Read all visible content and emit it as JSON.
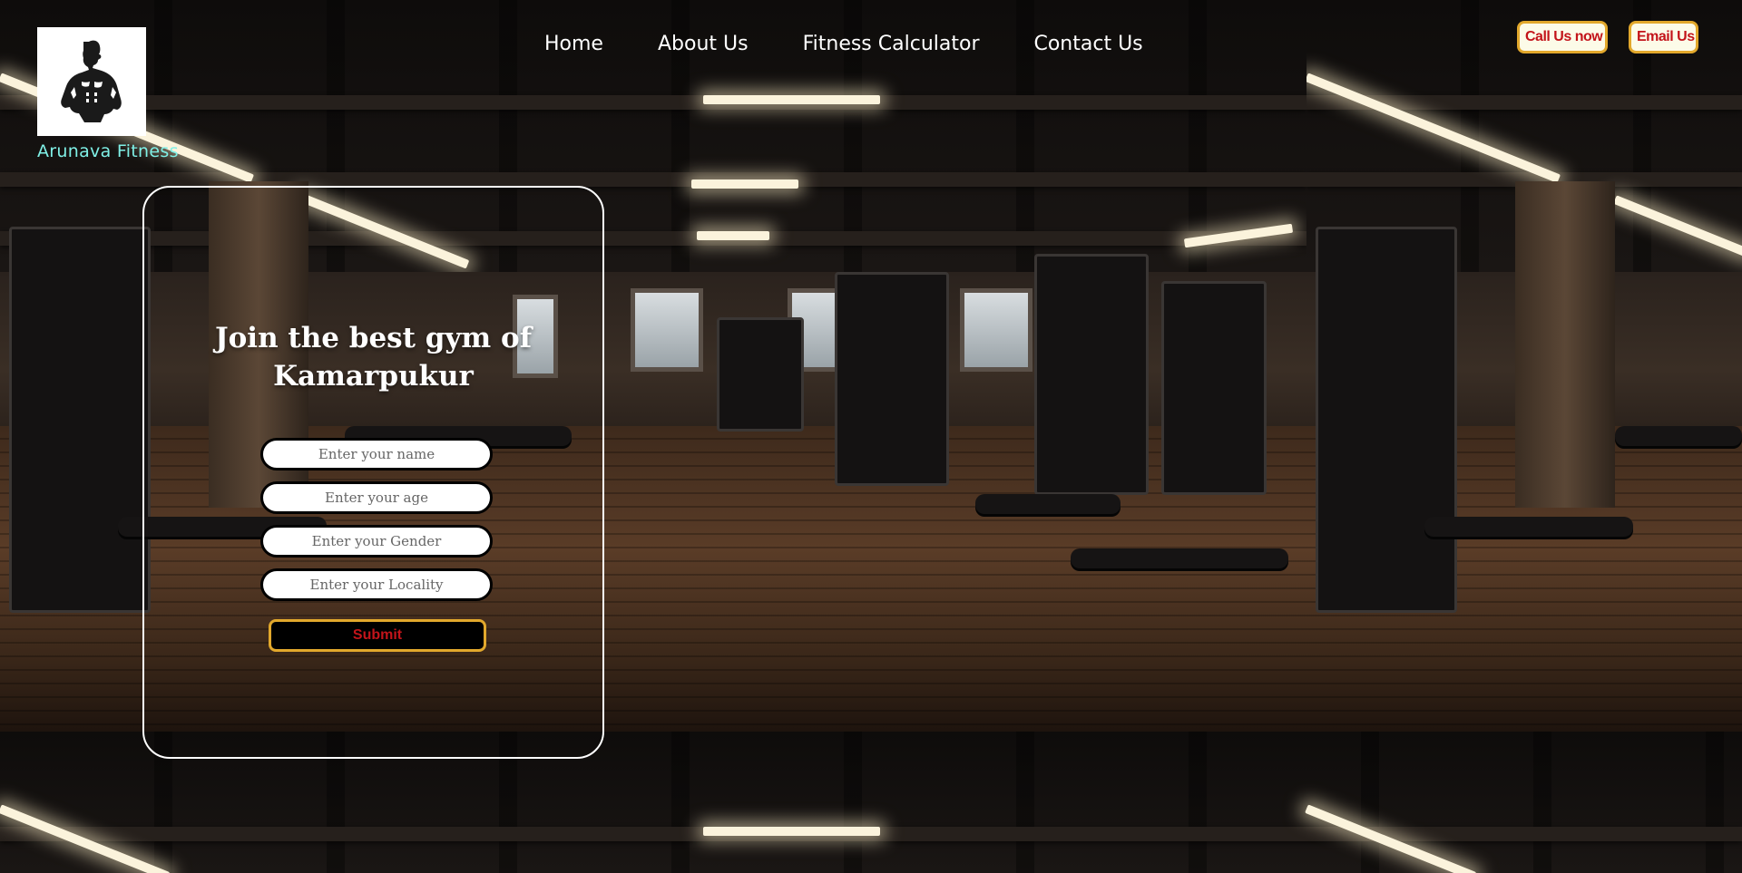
{
  "brand": {
    "logo_icon": "bodybuilder-logo-icon",
    "name": "Arunava Fitness",
    "name_color": "#7ff0e6"
  },
  "nav": {
    "items": [
      {
        "label": "Home"
      },
      {
        "label": "About Us"
      },
      {
        "label": "Fitness Calculator"
      },
      {
        "label": "Contact Us"
      }
    ]
  },
  "actions": {
    "call_label": "Call Us now",
    "email_label": "Email Us",
    "accent_border": "#e2a82c",
    "accent_text": "#c3141a"
  },
  "form": {
    "title_line1": "Join the best gym of",
    "title_line2": "Kamarpukur",
    "fields": [
      {
        "placeholder": "Enter your name",
        "value": ""
      },
      {
        "placeholder": "Enter your age",
        "value": ""
      },
      {
        "placeholder": "Enter your Gender",
        "value": ""
      },
      {
        "placeholder": "Enter your Locality",
        "value": ""
      }
    ],
    "submit_label": "Submit"
  }
}
